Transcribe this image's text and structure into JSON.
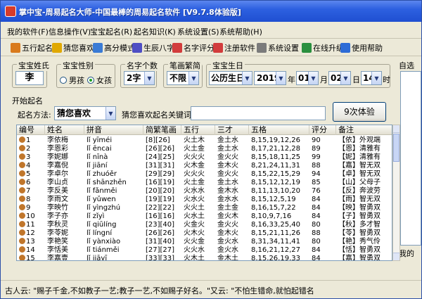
{
  "window": {
    "title": "掌中宝-周易起名大师-中国最棒的周易起名软件 [V9.7.8体验版]"
  },
  "menu": [
    "我的软件(F)",
    "信息操作(V)",
    "宝宝起名(R)",
    "起名知识(K)",
    "系统设置(S)",
    "系统帮助(H)"
  ],
  "toolbar": [
    {
      "label": "五行起名",
      "icon": "bagua-icon",
      "color": "#d97a1c"
    },
    {
      "label": "猜您喜欢",
      "icon": "star-icon",
      "color": "#e0a800"
    },
    {
      "label": "高分模式",
      "icon": "chart-icon",
      "color": "#3a7bd5"
    },
    {
      "label": "生辰八字",
      "icon": "grid-icon",
      "color": "#4e4ec4"
    },
    {
      "label": "名字评分",
      "icon": "score-icon",
      "color": "#d23c3c"
    },
    {
      "label": "注册软件",
      "icon": "register-icon",
      "color": "#d23c3c"
    },
    {
      "label": "系统设置",
      "icon": "settings-icon",
      "color": "#7b7b7b"
    },
    {
      "label": "在线升级",
      "icon": "globe-icon",
      "color": "#2a8f3e"
    },
    {
      "label": "使用帮助",
      "icon": "help-icon",
      "color": "#2d6bd6"
    }
  ],
  "settings": {
    "surname_label": "宝宝姓氏",
    "surname_value": "李",
    "gender_label": "宝宝性别",
    "gender_male": "男孩",
    "gender_female": "女孩",
    "gender_selected": "女孩",
    "name_length_label": "名字个数",
    "name_length_value": "2字",
    "script_label": "笔画繁简",
    "script_value": "不限",
    "birthday_label": "宝宝生日",
    "calendar_value": "公历生日",
    "year_value": "2019",
    "year_unit": "年",
    "month_value": "01",
    "month_unit": "月",
    "day_value": "02",
    "day_unit": "日",
    "hour_value": "14",
    "hour_unit": "时"
  },
  "naming": {
    "section_label": "开始起名",
    "method_label": "起名方法:",
    "method_value": "猜您喜欢",
    "keyword_label": "猜您喜欢起名关键词:",
    "keyword_value": "",
    "run_button": "9次体验"
  },
  "table": {
    "columns": [
      "编号",
      "姓名",
      "拼音",
      "简繁笔画",
      "五行",
      "三才",
      "五格",
      "评分",
      "备注"
    ],
    "rows": [
      [
        "1",
        "李依梅",
        "lǐ yīméi",
        "[8][26]",
        "火土木",
        "金土水",
        "8,15,19,12,26",
        "90",
        "【依】外观端"
      ],
      [
        "2",
        "李恩彩",
        "lǐ ēncai",
        "[26][26]",
        "火土金",
        "金土水",
        "8,17,21,12,28",
        "89",
        "【恩】清雅有"
      ],
      [
        "3",
        "李妮娜",
        "lǐ nīnà",
        "[24][25]",
        "火火火",
        "金火火",
        "8,15,18,11,25",
        "99",
        "【妮】清雅有"
      ],
      [
        "4",
        "李嘉倪",
        "lǐ jiāní",
        "[31][31]",
        "火木金",
        "金木火",
        "8,21,24,11,31",
        "88",
        "【嘉】智无双"
      ],
      [
        "5",
        "李卓尔",
        "lǐ zhuóěr",
        "[29][29]",
        "火火火",
        "金火火",
        "8,15,22,15,29",
        "94",
        "【卓】智无双"
      ],
      [
        "6",
        "李山贞",
        "lǐ shānzhēn",
        "[16][19]",
        "火土金",
        "金土水",
        "8,15,12,12,19",
        "85",
        "【山】父母子"
      ],
      [
        "7",
        "李反美",
        "lǐ fǎnměi",
        "[20][20]",
        "火水水",
        "金木水",
        "8,11,13,10,20",
        "76",
        "【反】奔波劳"
      ],
      [
        "8",
        "李雨文",
        "lǐ yǔwen",
        "[19][19]",
        "火水火",
        "金水水",
        "8,15,12,5,19",
        "84",
        "【雨】智无双"
      ],
      [
        "9",
        "李映竹",
        "lǐ yìngzhú",
        "[22][22]",
        "火火土",
        "金土金",
        "8,16,15,7,22",
        "84",
        "【映】智勇双"
      ],
      [
        "10",
        "李子亦",
        "lǐ zǐyì",
        "[16][16]",
        "火水土",
        "金火木",
        "8,10,9,7,16",
        "84",
        "【子】智勇双"
      ],
      [
        "11",
        "李秋灵",
        "lǐ qiūlíng",
        "[23][40]",
        "火金火",
        "金火火",
        "8,16,33,25,40",
        "80",
        "【秋】多才智"
      ],
      [
        "12",
        "李苓妮",
        "lǐ língní",
        "[26][26]",
        "火木火",
        "金木火",
        "8,15,21,11,26",
        "88",
        "【苓】智勇双"
      ],
      [
        "13",
        "李艳笑",
        "lǐ yànxiào",
        "[31][40]",
        "火火金",
        "金火水",
        "8,31,34,11,41",
        "80",
        "【艳】秀气伶"
      ],
      [
        "14",
        "李恬美",
        "lǐ tiánměi",
        "[27][27]",
        "火火水",
        "金火水",
        "8,16,21,12,27",
        "84",
        "【恬】智勇双"
      ],
      [
        "15",
        "李嘉壹",
        "lǐ jiāyī",
        "[33][33]",
        "火木土",
        "金木土",
        "8,15,26,19,33",
        "84",
        "【嘉】智勇双"
      ]
    ]
  },
  "right_panel": {
    "top_label": "自选",
    "bottom_label": "我的"
  },
  "status": {
    "text": "古人云: \"赐子千金,不如教子一艺;教子一艺,不如赐子好名。\"又云: \"不怕生错命,就怕起错名"
  },
  "colors": {
    "titlebar": "#2d60e0",
    "window_bg": "#ece9d8",
    "border": "#7f9db9"
  }
}
